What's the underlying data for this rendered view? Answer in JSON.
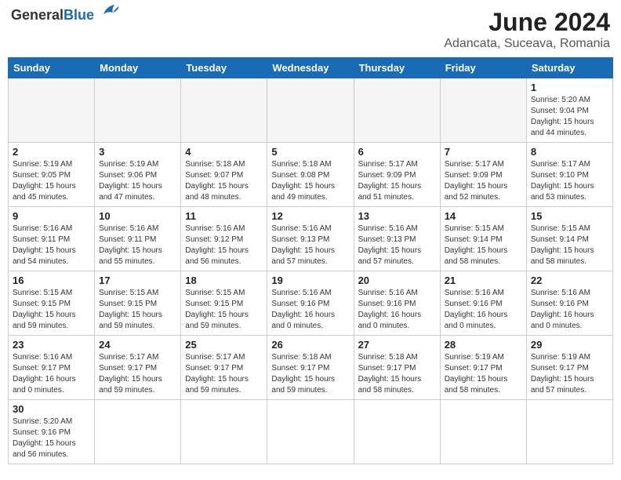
{
  "header": {
    "logo_general": "General",
    "logo_blue": "Blue",
    "title": "June 2024",
    "subtitle": "Adancata, Suceava, Romania"
  },
  "weekdays": [
    "Sunday",
    "Monday",
    "Tuesday",
    "Wednesday",
    "Thursday",
    "Friday",
    "Saturday"
  ],
  "days": [
    {
      "num": "",
      "info": ""
    },
    {
      "num": "",
      "info": ""
    },
    {
      "num": "",
      "info": ""
    },
    {
      "num": "",
      "info": ""
    },
    {
      "num": "",
      "info": ""
    },
    {
      "num": "",
      "info": ""
    },
    {
      "num": "1",
      "info": "Sunrise: 5:20 AM\nSunset: 9:04 PM\nDaylight: 15 hours\nand 44 minutes."
    },
    {
      "num": "2",
      "info": "Sunrise: 5:19 AM\nSunset: 9:05 PM\nDaylight: 15 hours\nand 45 minutes."
    },
    {
      "num": "3",
      "info": "Sunrise: 5:19 AM\nSunset: 9:06 PM\nDaylight: 15 hours\nand 47 minutes."
    },
    {
      "num": "4",
      "info": "Sunrise: 5:18 AM\nSunset: 9:07 PM\nDaylight: 15 hours\nand 48 minutes."
    },
    {
      "num": "5",
      "info": "Sunrise: 5:18 AM\nSunset: 9:08 PM\nDaylight: 15 hours\nand 49 minutes."
    },
    {
      "num": "6",
      "info": "Sunrise: 5:17 AM\nSunset: 9:09 PM\nDaylight: 15 hours\nand 51 minutes."
    },
    {
      "num": "7",
      "info": "Sunrise: 5:17 AM\nSunset: 9:09 PM\nDaylight: 15 hours\nand 52 minutes."
    },
    {
      "num": "8",
      "info": "Sunrise: 5:17 AM\nSunset: 9:10 PM\nDaylight: 15 hours\nand 53 minutes."
    },
    {
      "num": "9",
      "info": "Sunrise: 5:16 AM\nSunset: 9:11 PM\nDaylight: 15 hours\nand 54 minutes."
    },
    {
      "num": "10",
      "info": "Sunrise: 5:16 AM\nSunset: 9:11 PM\nDaylight: 15 hours\nand 55 minutes."
    },
    {
      "num": "11",
      "info": "Sunrise: 5:16 AM\nSunset: 9:12 PM\nDaylight: 15 hours\nand 56 minutes."
    },
    {
      "num": "12",
      "info": "Sunrise: 5:16 AM\nSunset: 9:13 PM\nDaylight: 15 hours\nand 57 minutes."
    },
    {
      "num": "13",
      "info": "Sunrise: 5:16 AM\nSunset: 9:13 PM\nDaylight: 15 hours\nand 57 minutes."
    },
    {
      "num": "14",
      "info": "Sunrise: 5:15 AM\nSunset: 9:14 PM\nDaylight: 15 hours\nand 58 minutes."
    },
    {
      "num": "15",
      "info": "Sunrise: 5:15 AM\nSunset: 9:14 PM\nDaylight: 15 hours\nand 58 minutes."
    },
    {
      "num": "16",
      "info": "Sunrise: 5:15 AM\nSunset: 9:15 PM\nDaylight: 15 hours\nand 59 minutes."
    },
    {
      "num": "17",
      "info": "Sunrise: 5:15 AM\nSunset: 9:15 PM\nDaylight: 15 hours\nand 59 minutes."
    },
    {
      "num": "18",
      "info": "Sunrise: 5:15 AM\nSunset: 9:15 PM\nDaylight: 15 hours\nand 59 minutes."
    },
    {
      "num": "19",
      "info": "Sunrise: 5:16 AM\nSunset: 9:16 PM\nDaylight: 16 hours\nand 0 minutes."
    },
    {
      "num": "20",
      "info": "Sunrise: 5:16 AM\nSunset: 9:16 PM\nDaylight: 16 hours\nand 0 minutes."
    },
    {
      "num": "21",
      "info": "Sunrise: 5:16 AM\nSunset: 9:16 PM\nDaylight: 16 hours\nand 0 minutes."
    },
    {
      "num": "22",
      "info": "Sunrise: 5:16 AM\nSunset: 9:16 PM\nDaylight: 16 hours\nand 0 minutes."
    },
    {
      "num": "23",
      "info": "Sunrise: 5:16 AM\nSunset: 9:17 PM\nDaylight: 16 hours\nand 0 minutes."
    },
    {
      "num": "24",
      "info": "Sunrise: 5:17 AM\nSunset: 9:17 PM\nDaylight: 15 hours\nand 59 minutes."
    },
    {
      "num": "25",
      "info": "Sunrise: 5:17 AM\nSunset: 9:17 PM\nDaylight: 15 hours\nand 59 minutes."
    },
    {
      "num": "26",
      "info": "Sunrise: 5:18 AM\nSunset: 9:17 PM\nDaylight: 15 hours\nand 59 minutes."
    },
    {
      "num": "27",
      "info": "Sunrise: 5:18 AM\nSunset: 9:17 PM\nDaylight: 15 hours\nand 58 minutes."
    },
    {
      "num": "28",
      "info": "Sunrise: 5:19 AM\nSunset: 9:17 PM\nDaylight: 15 hours\nand 58 minutes."
    },
    {
      "num": "29",
      "info": "Sunrise: 5:19 AM\nSunset: 9:17 PM\nDaylight: 15 hours\nand 57 minutes."
    },
    {
      "num": "30",
      "info": "Sunrise: 5:20 AM\nSunset: 9:16 PM\nDaylight: 15 hours\nand 56 minutes."
    }
  ]
}
